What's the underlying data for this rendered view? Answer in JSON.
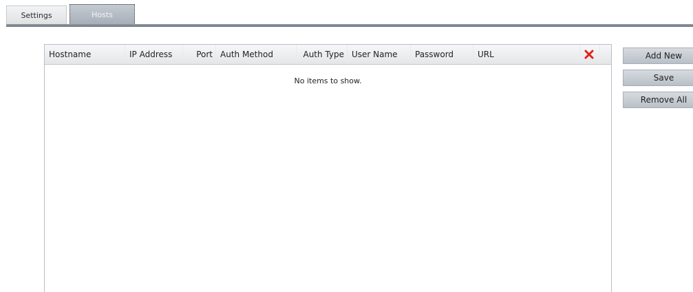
{
  "tabs": {
    "settings": "Settings",
    "hosts": "Hosts"
  },
  "grid": {
    "columns": [
      "Hostname",
      "IP Address",
      "Port",
      "Auth Method",
      "Auth Type",
      "User Name",
      "Password",
      "URL"
    ],
    "empty_message": "No items to show.",
    "delete_icon": "red-x-icon"
  },
  "buttons": {
    "add_new": "Add New",
    "save": "Save",
    "remove_all": "Remove All"
  },
  "colors": {
    "delete_icon": "#e0201b",
    "active_tab": "#aeb6bf",
    "tab_underline": "#7a848e"
  }
}
